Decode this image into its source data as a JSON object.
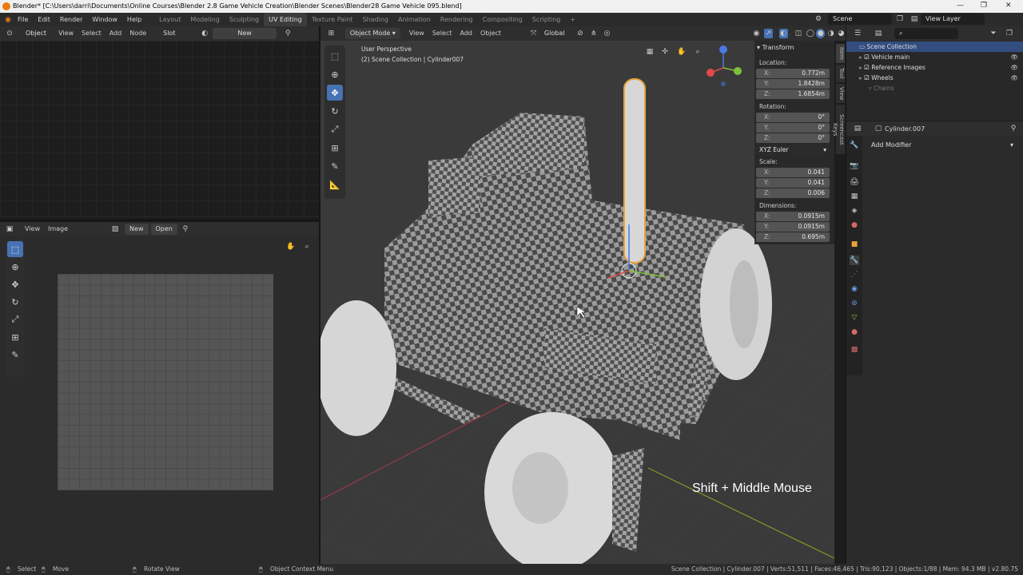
{
  "titlebar": {
    "title": "Blender* [C:\\Users\\darri\\Documents\\Online Courses\\Blender 2.8 Game Vehicle Creation\\Blender Scenes\\Blender28 Game Vehicle 095.blend]",
    "minimize": "—",
    "maximize": "❐",
    "close": "✕"
  },
  "menubar": {
    "items": [
      "File",
      "Edit",
      "Render",
      "Window",
      "Help"
    ]
  },
  "workspaces": [
    "Layout",
    "Modeling",
    "Sculpting",
    "UV Editing",
    "Texture Paint",
    "Shading",
    "Animation",
    "Rendering",
    "Compositing",
    "Scripting"
  ],
  "active_workspace": "UV Editing",
  "scene": {
    "name": "Scene",
    "view_layer": "View Layer"
  },
  "node_header": {
    "mode": "Object",
    "items": [
      "View",
      "Select",
      "Add",
      "Node"
    ],
    "slot": "Slot",
    "new_label": "New"
  },
  "image_header": {
    "items": [
      "View",
      "Image"
    ],
    "new_label": "New",
    "open_label": "Open"
  },
  "viewport_header": {
    "mode": "Object Mode",
    "items": [
      "View",
      "Select",
      "Add",
      "Object"
    ],
    "orientation": "Global"
  },
  "viewport": {
    "perspective": "User Perspective",
    "collection_info": "(2) Scene Collection | Cylinder007",
    "overlay_text": "Shift + Middle Mouse"
  },
  "transform": {
    "title": "Transform",
    "location_label": "Location:",
    "location": [
      {
        "axis": "X:",
        "value": "0.772m"
      },
      {
        "axis": "Y:",
        "value": "1.8428m"
      },
      {
        "axis": "Z:",
        "value": "1.6854m"
      }
    ],
    "rotation_label": "Rotation:",
    "rotation": [
      {
        "axis": "X:",
        "value": "0°"
      },
      {
        "axis": "Y:",
        "value": "0°"
      },
      {
        "axis": "Z:",
        "value": "0°"
      }
    ],
    "rotation_mode": "XYZ Euler",
    "scale_label": "Scale:",
    "scale": [
      {
        "axis": "X:",
        "value": "0.041"
      },
      {
        "axis": "Y:",
        "value": "0.041"
      },
      {
        "axis": "Z:",
        "value": "0.006"
      }
    ],
    "dimensions_label": "Dimensions:",
    "dimensions": [
      {
        "axis": "X:",
        "value": "0.0915m"
      },
      {
        "axis": "Y:",
        "value": "0.0915m"
      },
      {
        "axis": "Z:",
        "value": "0.695m"
      }
    ]
  },
  "sidebar_tabs": [
    "Item",
    "Tool",
    "View",
    "Screencast Keys"
  ],
  "outliner": {
    "root": "Scene Collection",
    "items": [
      "Vehicle main",
      "Reference Images",
      "Wheels",
      "Chains"
    ]
  },
  "properties": {
    "object_name": "Cylinder.007",
    "add_modifier": "Add Modifier"
  },
  "statusbar": {
    "select": "Select",
    "move": "Move",
    "rotate": "Rotate View",
    "context": "Object Context Menu",
    "stats": "Scene Collection | Cylinder.007 | Verts:51,511 | Faces:46,465 | Tris:90,123 | Objects:1/88 | Mem: 94.3 MB | v2.80.75"
  },
  "colors": {
    "accent": "#4772b3",
    "selection": "#e8a33d",
    "blender_orange": "#e87d0d"
  }
}
